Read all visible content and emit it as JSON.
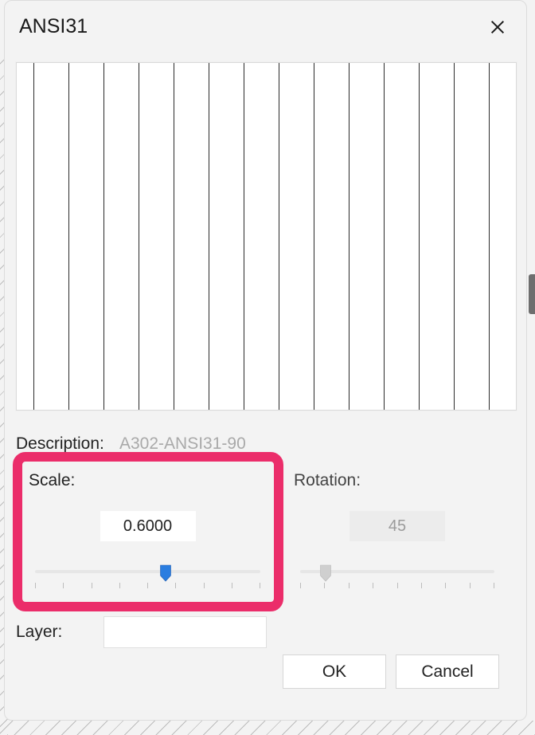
{
  "title": "ANSI31",
  "preview": {
    "stripe_count": 14
  },
  "description": {
    "label": "Description:",
    "value": "A302-ANSI31-90"
  },
  "scale": {
    "label": "Scale:",
    "value": "0.6000",
    "slider_percent": 58
  },
  "rotation": {
    "label": "Rotation:",
    "value": "45",
    "slider_percent": 13
  },
  "layer": {
    "label": "Layer:",
    "value": ""
  },
  "buttons": {
    "ok": "OK",
    "cancel": "Cancel"
  },
  "highlight_color": "#eb2d6a"
}
